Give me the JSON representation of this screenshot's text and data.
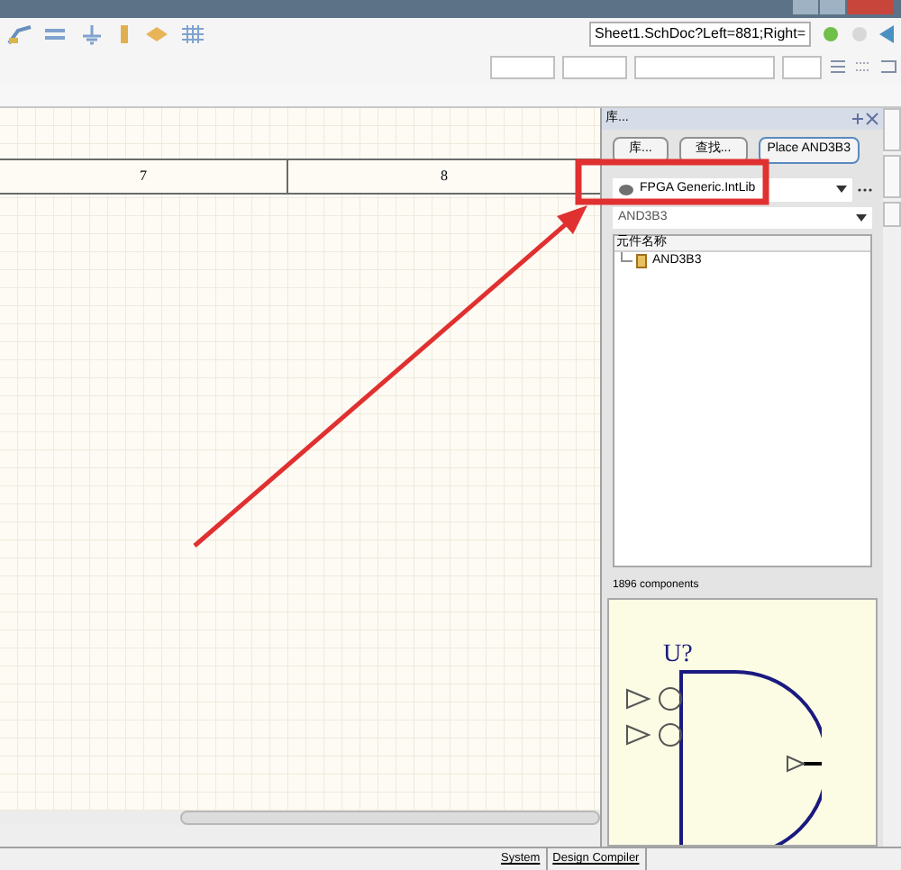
{
  "toolbar": {
    "document_field": "Sheet1.SchDoc?Left=881;Right="
  },
  "sheet_border": {
    "columns": [
      "7",
      "8"
    ]
  },
  "library_panel": {
    "title": "库...",
    "buttons": [
      "库...",
      "查找...",
      "Place AND3B3"
    ],
    "library": "FPGA Generic.IntLib",
    "filter": "AND3B3",
    "list_header": "元件名称",
    "items": [
      {
        "name": "AND3B3",
        "selected": false
      }
    ],
    "count": "1896 components",
    "preview_designator": "U?"
  },
  "status_tabs": [
    "System",
    "Design Compiler"
  ]
}
